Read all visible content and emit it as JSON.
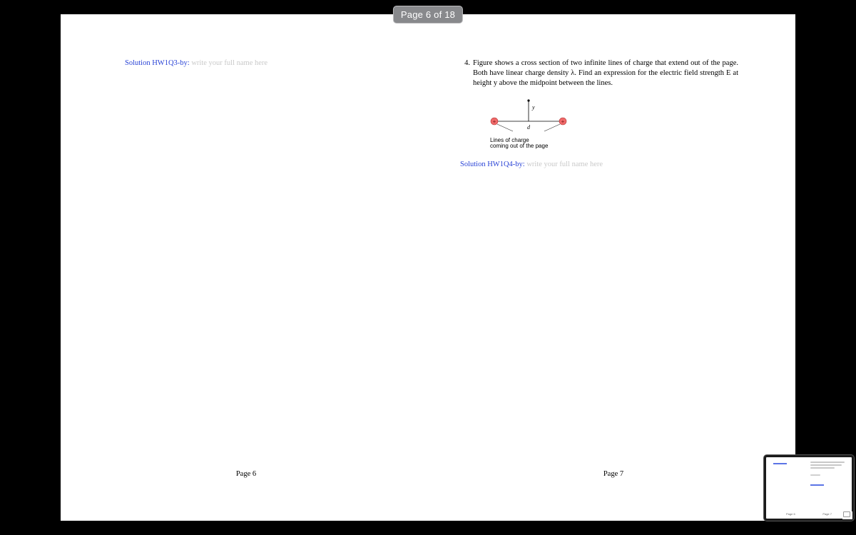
{
  "hud": {
    "text": "Page 6 of 18"
  },
  "left": {
    "solution_label": "Solution HW1Q3-by:",
    "placeholder": "write your full name here",
    "footer": "Page 6"
  },
  "right": {
    "problem_number": "4.",
    "problem_text": "Figure shows a cross section of two infinite lines of charge that extend out of the page. Both have linear charge density λ. Find an expression for the electric field strength E at height y above the midpoint between the lines.",
    "figure": {
      "y_label": "y",
      "d_label": "d",
      "plus": "+",
      "caption_line1": "Lines of charge",
      "caption_line2": "coming out of the page"
    },
    "solution_label": "Solution HW1Q4-by:",
    "placeholder": "write your full name here",
    "footer": "Page 7"
  },
  "thumbnail": {
    "foot_left": "Page 6",
    "foot_right": "Page 7"
  }
}
